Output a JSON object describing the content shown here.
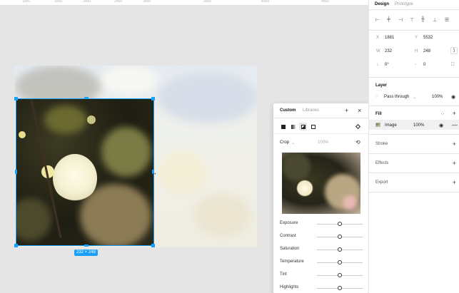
{
  "ruler": {
    "ticks": [
      "1000",
      "1500",
      "2000",
      "2500",
      "3000",
      "3500",
      "4000",
      "4500"
    ]
  },
  "canvas": {
    "dimension_badge": "232 × 248"
  },
  "popover": {
    "tabs": [
      {
        "label": "Custom"
      },
      {
        "label": "Libraries"
      }
    ],
    "add_icon": "+",
    "close_icon": "×",
    "crop_mode": "Crop",
    "crop_percent": "100%",
    "adjustments": [
      {
        "label": "Exposure",
        "value": 0.5
      },
      {
        "label": "Contrast",
        "value": 0.5
      },
      {
        "label": "Saturation",
        "value": 0.5
      },
      {
        "label": "Temperature",
        "value": 0.5
      },
      {
        "label": "Tint",
        "value": 0.5
      },
      {
        "label": "Highlights",
        "value": 0.5
      }
    ]
  },
  "panel": {
    "tabs": [
      {
        "label": "Design"
      },
      {
        "label": "Prototype"
      }
    ],
    "geometry": {
      "x_label": "X",
      "x_value": "1881",
      "y_label": "Y",
      "y_value": "5532",
      "w_label": "W",
      "w_value": "232",
      "h_label": "H",
      "h_value": "248",
      "rotation": "0°",
      "radius": "0"
    },
    "layer": {
      "title": "Layer",
      "blend": "Pass through",
      "opacity": "100%"
    },
    "fill": {
      "title": "Fill",
      "type": "Image",
      "opacity": "100%"
    },
    "stroke": {
      "title": "Stroke"
    },
    "effects": {
      "title": "Effects"
    },
    "export": {
      "title": "Export"
    }
  },
  "colors": {
    "accent": "#18a0fb"
  }
}
